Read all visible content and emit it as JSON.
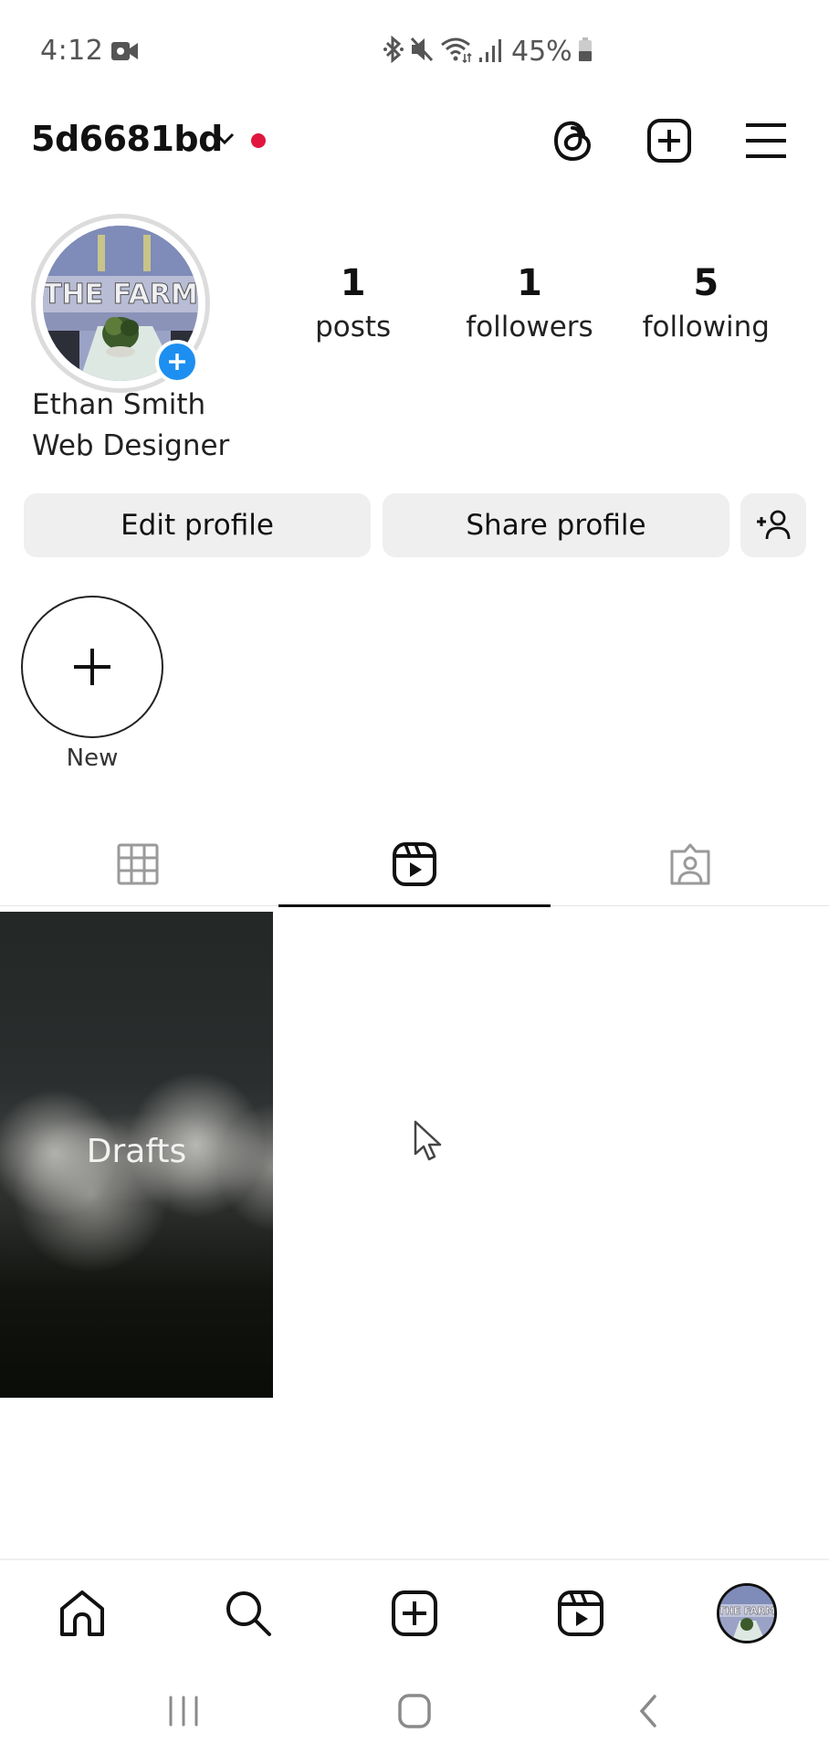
{
  "status_bar": {
    "time": "4:12",
    "battery": "45%",
    "icons": [
      "video-record-icon",
      "bluetooth-icon",
      "mute-icon",
      "wifi-icon",
      "signal-icon",
      "battery-icon"
    ]
  },
  "header": {
    "username": "5d6681bd",
    "icons": [
      "threads-icon",
      "create-icon",
      "menu-icon"
    ],
    "notification_dot_color": "#e0163e"
  },
  "profile": {
    "avatar_alt": "THE FARM",
    "stats": [
      {
        "value": "1",
        "label": "posts"
      },
      {
        "value": "1",
        "label": "followers"
      },
      {
        "value": "5",
        "label": "following"
      }
    ],
    "full_name": "Ethan Smith",
    "bio": "Web Designer",
    "add_story_color": "#1d8ff0"
  },
  "buttons": {
    "edit_profile": "Edit profile",
    "share_profile": "Share profile",
    "discover_people_icon": "add-person-icon"
  },
  "highlights": {
    "new_label": "New"
  },
  "tabs": [
    {
      "name": "posts",
      "icon": "grid-icon",
      "active": false
    },
    {
      "name": "reels",
      "icon": "reels-icon",
      "active": true
    },
    {
      "name": "tagged",
      "icon": "tagged-icon",
      "active": false
    }
  ],
  "content": {
    "drafts_label": "Drafts"
  },
  "bottom_nav": [
    "home-icon",
    "search-icon",
    "create-icon",
    "reels-icon",
    "profile-avatar"
  ],
  "system_nav": [
    "recents-icon",
    "home-icon",
    "back-icon"
  ]
}
